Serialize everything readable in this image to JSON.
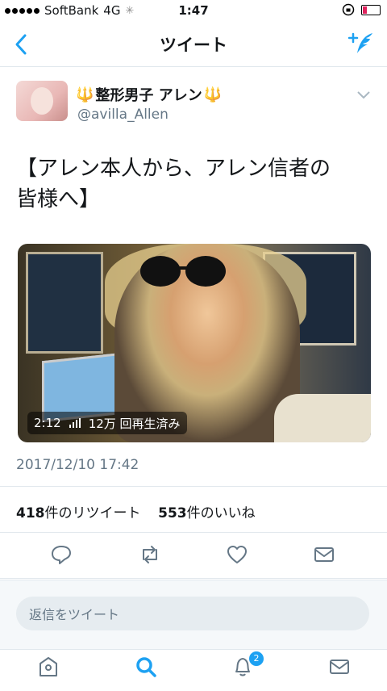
{
  "status_bar": {
    "carrier": "SoftBank",
    "network": "4G",
    "time": "1:47"
  },
  "nav": {
    "title": "ツイート"
  },
  "author": {
    "name": "整形男子 アレン",
    "handle": "@avilla_Allen"
  },
  "tweet": {
    "text_line1": "【アレン本人から、アレン信者の",
    "text_line2": "皆様へ】",
    "timestamp": "2017/12/10 17:42"
  },
  "video": {
    "duration": "2:12",
    "views": "12万 回再生済み"
  },
  "stats": {
    "retweets": "418",
    "retweets_label": "件のリツイート",
    "likes": "553",
    "likes_label": "件のいいね"
  },
  "reply": {
    "placeholder": "返信をツイート"
  },
  "tabs": {
    "notification_count": "2"
  },
  "colors": {
    "accent": "#1da1f2",
    "icon_gray": "#657786",
    "text": "#14171a"
  }
}
